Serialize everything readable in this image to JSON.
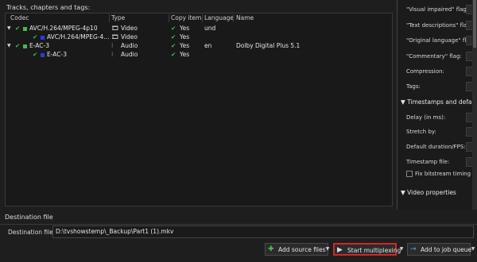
{
  "tracks_panel": {
    "label": "Tracks, chapters and tags:",
    "columns": [
      "Codec",
      "Type",
      "Copy item",
      "Language",
      "Name"
    ],
    "rows": [
      {
        "indent": 0,
        "color": "#49b84f",
        "codec": "AVC/H.264/MPEG-4p10",
        "type": "Video",
        "copy": "Yes",
        "language": "und",
        "name": ""
      },
      {
        "indent": 1,
        "color": "#2a3bd6",
        "codec": "AVC/H.264/MPEG-4...",
        "type": "Video",
        "copy": "Yes",
        "language": "",
        "name": ""
      },
      {
        "indent": 0,
        "color": "#49b84f",
        "codec": "E-AC-3",
        "type": "Audio",
        "copy": "Yes",
        "language": "en",
        "name": "Dolby Digital Plus 5.1"
      },
      {
        "indent": 1,
        "color": "#2a3bd6",
        "codec": "E-AC-3",
        "type": "Audio",
        "copy": "Yes",
        "language": "",
        "name": ""
      }
    ]
  },
  "properties_panel": {
    "items": [
      "\"Visual impaired\" flag:",
      "\"Text descriptions\" flag:",
      "\"Original language\" flag:",
      "\"Commentary\" flag:",
      "Compression:",
      "Tags:"
    ],
    "section_timestamps": "Timestamps and default",
    "timestamp_items": [
      "Delay (in ms):",
      "Stretch by:",
      "Default duration/FPS:",
      "Timestamp file:"
    ],
    "fix_bitstream": "Fix bitstream timing in",
    "section_video": "Video properties"
  },
  "destination": {
    "section_label": "Destination file",
    "field_label": "Destination file:",
    "value": "D:\\tvshowstemp\\_Backup\\Part1 (1).mkv"
  },
  "actions": {
    "add_source": "Add source files",
    "start": "Start multiplexing",
    "queue": "Add to job queue"
  }
}
